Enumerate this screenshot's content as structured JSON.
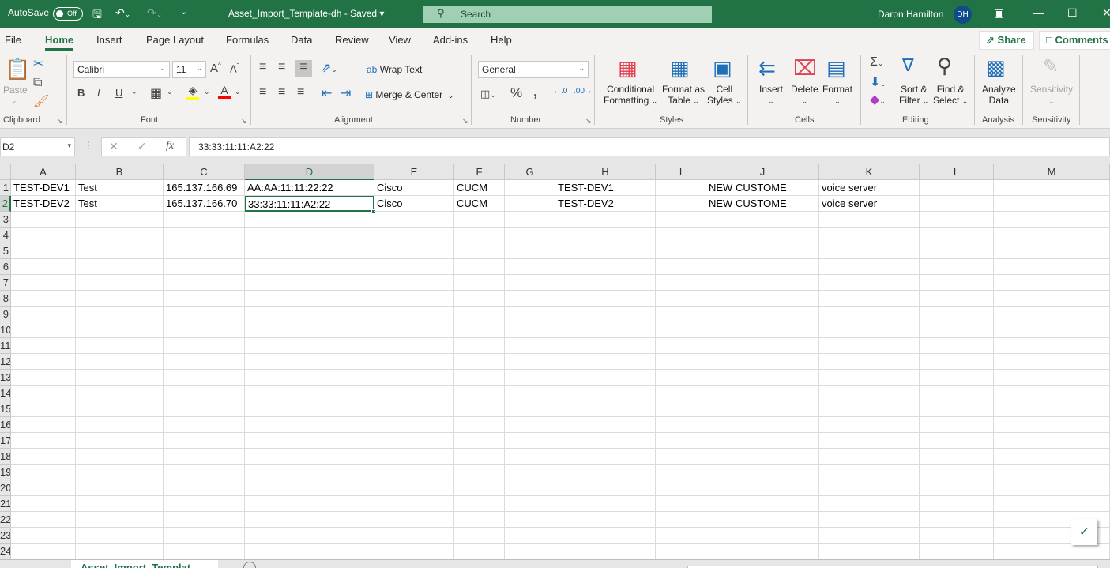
{
  "titlebar": {
    "autosave_label": "AutoSave",
    "autosave_state": "Off",
    "doc_title": "Asset_Import_Template-dh  -  Saved",
    "search_placeholder": "Search",
    "user_name": "Daron Hamilton",
    "user_initials": "DH"
  },
  "menu": {
    "tabs": [
      "File",
      "Home",
      "Insert",
      "Page Layout",
      "Formulas",
      "Data",
      "Review",
      "View",
      "Add-ins",
      "Help"
    ],
    "active": "Home",
    "share": "Share",
    "comments": "Comments"
  },
  "ribbon": {
    "clipboard": {
      "paste": "Paste",
      "label": "Clipboard"
    },
    "font": {
      "name": "Calibri",
      "size": "11",
      "label": "Font",
      "highlight_color": "#FFFF00",
      "font_color": "#FF0000"
    },
    "alignment": {
      "wrap_text": "Wrap Text",
      "merge_center": "Merge & Center",
      "label": "Alignment"
    },
    "number": {
      "format": "General",
      "label": "Number"
    },
    "styles": {
      "conditional_1": "Conditional",
      "conditional_2": "Formatting",
      "format_table_1": "Format as",
      "format_table_2": "Table",
      "cell_styles_1": "Cell",
      "cell_styles_2": "Styles",
      "label": "Styles"
    },
    "cells": {
      "insert": "Insert",
      "delete": "Delete",
      "format": "Format",
      "label": "Cells"
    },
    "editing": {
      "sort_1": "Sort &",
      "sort_2": "Filter",
      "find_1": "Find &",
      "find_2": "Select",
      "label": "Editing"
    },
    "analysis": {
      "analyze_1": "Analyze",
      "analyze_2": "Data",
      "label": "Analysis"
    },
    "sensitivity": {
      "button": "Sensitivity",
      "label": "Sensitivity"
    }
  },
  "formula_bar": {
    "name_box": "D2",
    "fx": "fx",
    "formula": "33:33:11:11:A2:22"
  },
  "sheet": {
    "columns": [
      "A",
      "B",
      "C",
      "D",
      "E",
      "F",
      "G",
      "H",
      "I",
      "J",
      "K",
      "L",
      "M"
    ],
    "selected_column": "D",
    "selected_row": 2,
    "row_numbers": [
      "1",
      "2",
      "3",
      "4",
      "5",
      "6",
      "7",
      "8",
      "9",
      "10",
      "11",
      "12",
      "13",
      "14",
      "15",
      "16",
      "17",
      "18",
      "19",
      "20",
      "21",
      "22",
      "23",
      "24"
    ],
    "rows": [
      [
        "TEST-DEV1",
        "Test",
        "165.137.166.69",
        "AA:AA:11:11:22:22",
        "Cisco",
        "CUCM",
        "",
        "TEST-DEV1",
        "",
        "NEW CUSTOME",
        "voice server",
        "",
        ""
      ],
      [
        "TEST-DEV2",
        "Test",
        "165.137.166.70",
        "33:33:11:11:A2:22",
        "Cisco",
        "CUCM",
        "",
        "TEST-DEV2",
        "",
        "NEW CUSTOME",
        "voice server",
        "",
        ""
      ]
    ],
    "tab_name": "Asset_Import_Templat..."
  },
  "colors": {
    "accent": "#217346",
    "search_bg": "#9FD0B3",
    "avatar": "#0F4A8A"
  }
}
